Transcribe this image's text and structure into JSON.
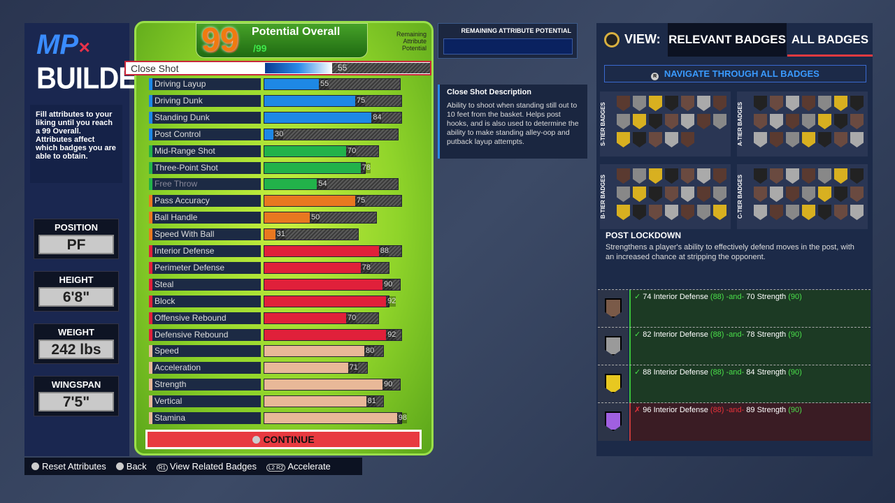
{
  "builder": {
    "logo": "MP",
    "logo_x": "×",
    "title": "BUILDER",
    "intro": "Fill attributes to your liking until you reach a 99 Overall. Attributes affect which badges you are able to obtain."
  },
  "info": [
    {
      "label": "POSITION",
      "value": "PF"
    },
    {
      "label": "HEIGHT",
      "value": "6'8\""
    },
    {
      "label": "WEIGHT",
      "value": "242 lbs"
    },
    {
      "label": "WINGSPAN",
      "value": "7'5\""
    }
  ],
  "overall": {
    "value": "99",
    "title": "Potential Overall",
    "max": "/99",
    "remaining_label": "Remaining Attribute Potential"
  },
  "selected": {
    "label": "Close Shot",
    "value": 55
  },
  "attributes": [
    {
      "label": "Driving Layup",
      "value": 55,
      "cap": 98,
      "color": "#1e88e5"
    },
    {
      "label": "Driving Dunk",
      "value": 75,
      "cap": 99,
      "color": "#1e88e5"
    },
    {
      "label": "Standing Dunk",
      "value": 84,
      "cap": 99,
      "color": "#1e88e5"
    },
    {
      "label": "Post Control",
      "value": 30,
      "cap": 97,
      "color": "#1e88e5"
    },
    {
      "label": "Mid-Range Shot",
      "value": 70,
      "cap": 86,
      "color": "#22b24a"
    },
    {
      "label": "Three-Point Shot",
      "value": 78,
      "cap": 79,
      "color": "#22b24a"
    },
    {
      "label": "Free Throw",
      "value": 54,
      "cap": 97,
      "color": "#22b24a"
    },
    {
      "label": "Pass Accuracy",
      "value": 75,
      "cap": 99,
      "color": "#e87820"
    },
    {
      "label": "Ball Handle",
      "value": 50,
      "cap": 85,
      "color": "#e87820"
    },
    {
      "label": "Speed With Ball",
      "value": 31,
      "cap": 75,
      "color": "#e87820"
    },
    {
      "label": "Interior Defense",
      "value": 88,
      "cap": 99,
      "color": "#e0203a"
    },
    {
      "label": "Perimeter Defense",
      "value": 78,
      "cap": 92,
      "color": "#e0203a"
    },
    {
      "label": "Steal",
      "value": 90,
      "cap": 98,
      "color": "#e0203a"
    },
    {
      "label": "Block",
      "value": 92,
      "cap": 92,
      "color": "#e0203a"
    },
    {
      "label": "Offensive Rebound",
      "value": 70,
      "cap": 86,
      "color": "#e0203a"
    },
    {
      "label": "Defensive Rebound",
      "value": 92,
      "cap": 99,
      "color": "#e0203a"
    },
    {
      "label": "Speed",
      "value": 80,
      "cap": 89,
      "color": "#e8b898"
    },
    {
      "label": "Acceleration",
      "value": 71,
      "cap": 80,
      "color": "#e8b898"
    },
    {
      "label": "Strength",
      "value": 90,
      "cap": 98,
      "color": "#e8b898"
    },
    {
      "label": "Vertical",
      "value": 81,
      "cap": 89,
      "color": "#e8b898"
    },
    {
      "label": "Stamina",
      "value": 98,
      "cap": 99,
      "color": "#e8b898"
    }
  ],
  "continue_label": "CONTINUE",
  "remaining_potential": {
    "title": "REMAINING ATTRIBUTE POTENTIAL"
  },
  "description": {
    "title": "Close Shot Description",
    "text": "Ability to shoot when standing still out to 10 feet from the basket. Helps post hooks, and is also used to determine the ability to make standing alley-oop and putback layup attempts."
  },
  "badges": {
    "view_label": "VIEW:",
    "tab_relevant": "RELEVANT BADGES",
    "tab_all": "ALL BADGES",
    "active_tab": "ALL BADGES",
    "nav": "NAVIGATE THROUGH ALL BADGES",
    "nav_button": "R",
    "tiers": [
      {
        "label": "S-TIER BADGES",
        "count": 19
      },
      {
        "label": "A-TIER BADGES",
        "count": 21
      },
      {
        "label": "B-TIER BADGES",
        "count": 21
      },
      {
        "label": "C-TIER BADGES",
        "count": 21
      }
    ],
    "selected_name": "POST LOCKDOWN",
    "selected_desc": "Strengthens a player's ability to effectively defend moves in the post, with an increased chance at stripping the opponent.",
    "requirements": [
      {
        "level": "bronze",
        "met": true,
        "color": "#7a5a48",
        "mark": "✓",
        "a": "74 Interior Defense",
        "av": "(88)",
        "and": "-and-",
        "b": "70 Strength",
        "bv": "(90)"
      },
      {
        "level": "silver",
        "met": true,
        "color": "#9a9a9a",
        "mark": "✓",
        "a": "82 Interior Defense",
        "av": "(88)",
        "and": "-and-",
        "b": "78 Strength",
        "bv": "(90)"
      },
      {
        "level": "gold",
        "met": true,
        "color": "#e8c820",
        "mark": "✓",
        "a": "88 Interior Defense",
        "av": "(88)",
        "and": "-and-",
        "b": "84 Strength",
        "bv": "(90)"
      },
      {
        "level": "hall-of-fame",
        "met": false,
        "color": "#a060e0",
        "mark": "✗",
        "a": "96 Interior Defense",
        "av": "(88)",
        "and": "-and-",
        "b": "89 Strength",
        "bv": "(90)"
      }
    ]
  },
  "footer": [
    {
      "label": "Reset Attributes"
    },
    {
      "label": "Back"
    },
    {
      "label": "View Related Badges",
      "button": "R1"
    },
    {
      "label": "Accelerate",
      "button": "L2 R2"
    }
  ]
}
